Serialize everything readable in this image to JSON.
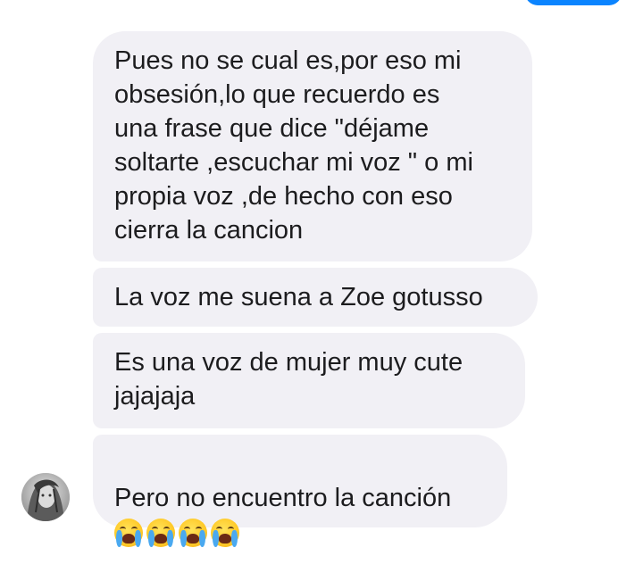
{
  "chat": {
    "messages": [
      {
        "text": "Pues no se cual es,por eso mi\nobsesión,lo que recuerdo es\nuna frase que dice \"déjame\nsoltarte ,escuchar mi voz \" o mi\npropia voz ,de hecho con eso\ncierra la cancion"
      },
      {
        "text": "La voz me suena a Zoe gotusso"
      },
      {
        "text": "Es una voz de mujer muy  cute\njajajaja"
      },
      {
        "text": "Pero no encuentro la canción",
        "emojis": [
          "loudly-crying-face",
          "loudly-crying-face",
          "loudly-crying-face",
          "loudly-crying-face"
        ]
      }
    ],
    "colors": {
      "incoming_bubble": "#f1f0f5",
      "outgoing_bubble": "#0b84ff",
      "text": "#1c1c1e"
    }
  }
}
